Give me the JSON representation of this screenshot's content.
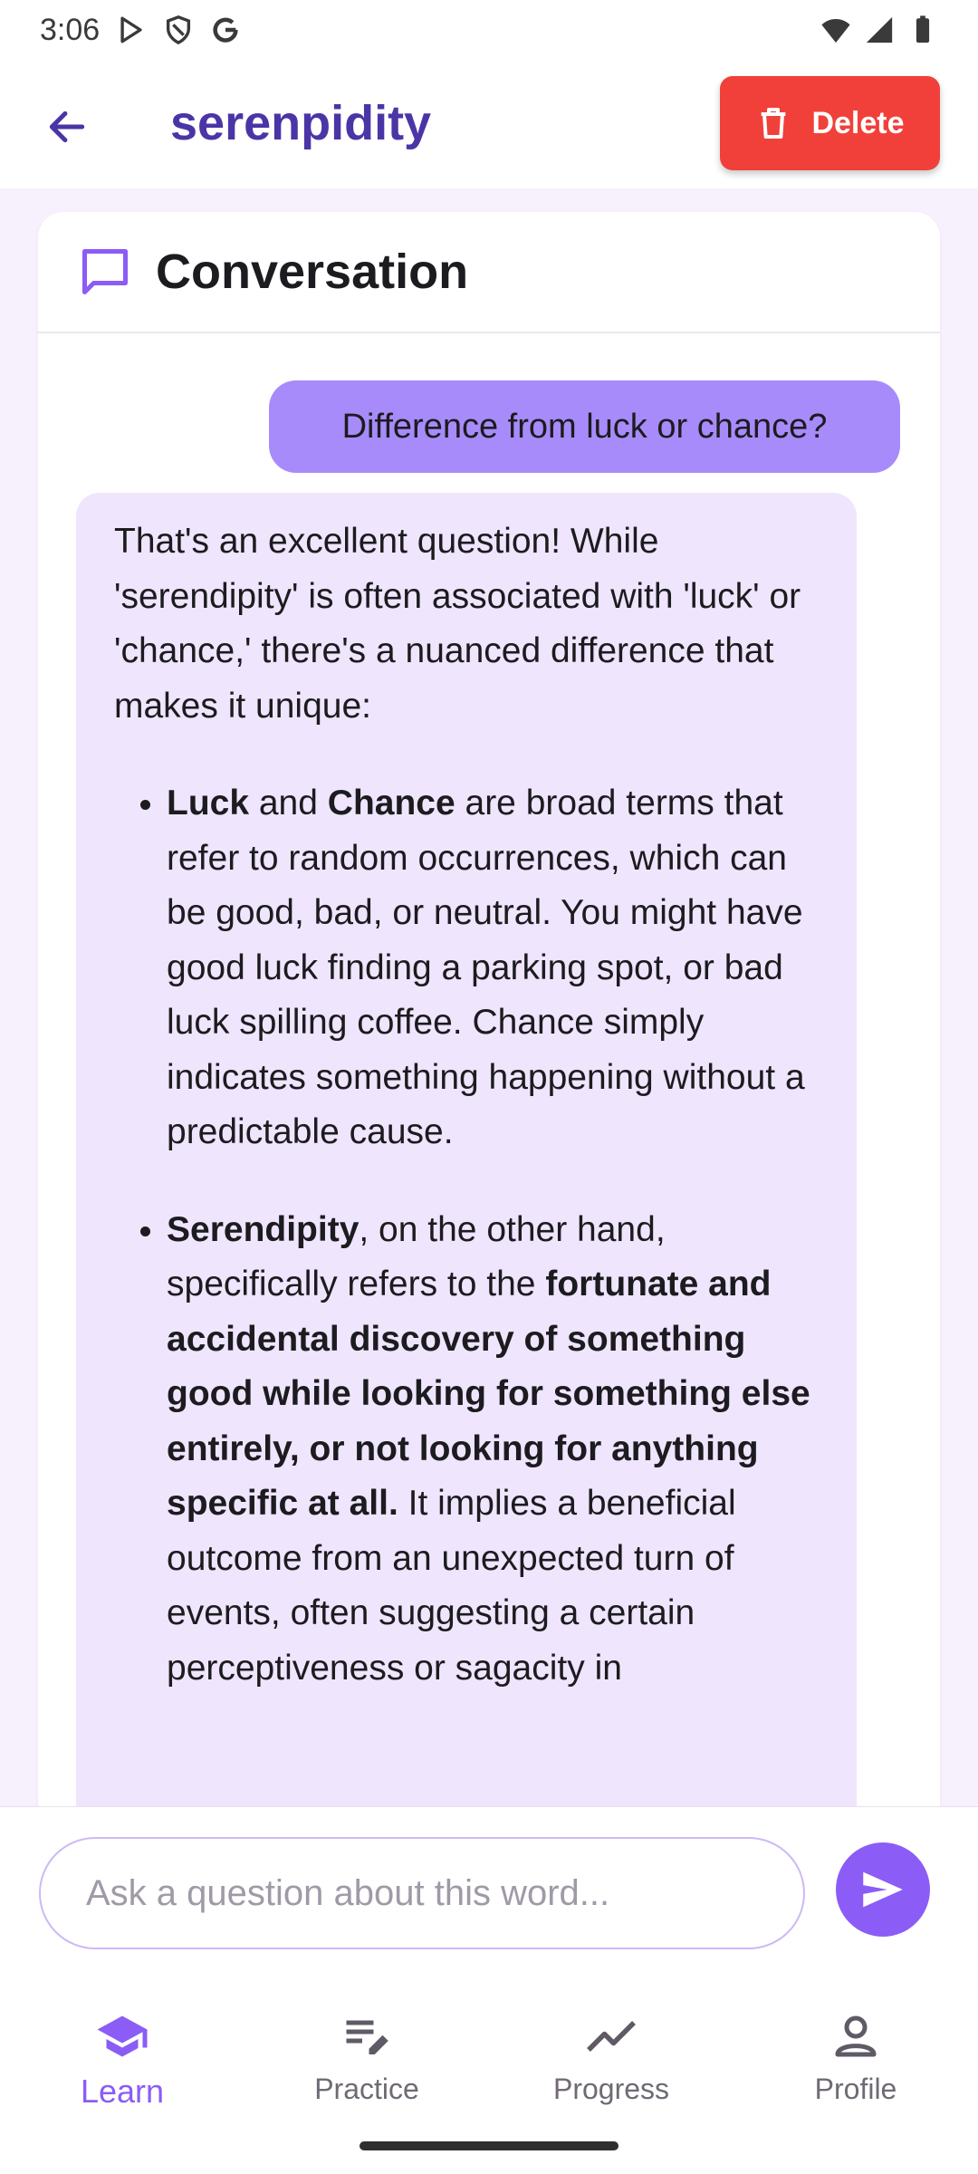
{
  "status_bar": {
    "time": "3:06",
    "icons": [
      "play-store-icon",
      "shield-icon",
      "google-icon",
      "wifi-icon",
      "signal-icon",
      "battery-icon"
    ]
  },
  "header": {
    "word": "serenpidity",
    "delete_label": "Delete",
    "icons": [
      "back-arrow-icon",
      "trash-icon"
    ]
  },
  "conversation": {
    "title": "Conversation",
    "icon": "chat-bubble-icon",
    "user_message": "Difference from luck or chance?",
    "ai_message": {
      "intro": "That's an excellent question! While 'serendipity' is often associated with 'luck' or 'chance,' there's a nuanced difference that makes it unique:",
      "bullet1": {
        "bold1": "Luck",
        "text1": " and ",
        "bold2": "Chance",
        "text2": " are broad terms that refer to random occurrences, which can be good, bad, or neutral. You might have good luck finding a parking spot, or bad luck spilling coffee. Chance simply indicates something happening without a predictable cause."
      },
      "bullet2": {
        "bold1": "Serendipity",
        "text1": ", on the other hand, specifically refers to the ",
        "bold2": "fortunate and accidental discovery of something good while looking for something else entirely, or not looking for anything specific at all.",
        "text2": " It implies a beneficial outcome from an unexpected turn of events, often suggesting a certain perceptiveness or sagacity in"
      }
    }
  },
  "input": {
    "placeholder": "Ask a question about this word...",
    "value": "",
    "send_icon": "send-icon"
  },
  "nav": {
    "items": [
      {
        "label": "Learn",
        "icon": "school-icon",
        "active": true
      },
      {
        "label": "Practice",
        "icon": "edit-note-icon",
        "active": false
      },
      {
        "label": "Progress",
        "icon": "trending-icon",
        "active": false
      },
      {
        "label": "Profile",
        "icon": "person-icon",
        "active": false
      }
    ]
  },
  "colors": {
    "accent": "#8b5cf6",
    "title": "#4b35a6",
    "delete": "#f1403a",
    "user_bubble": "#a78bfa",
    "ai_bubble": "#efe5fd"
  }
}
